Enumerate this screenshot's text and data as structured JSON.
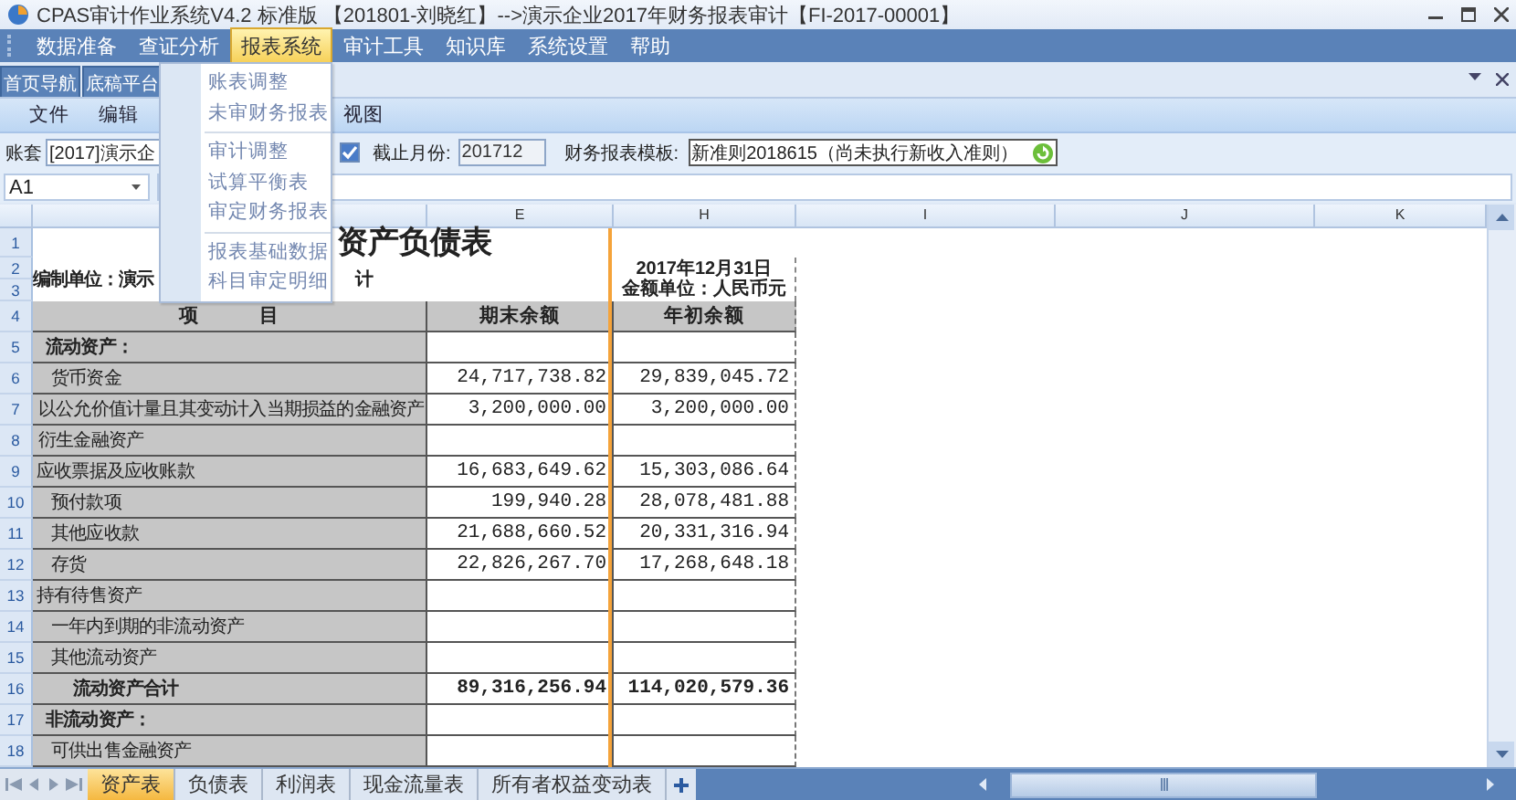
{
  "window": {
    "title": "CPAS审计作业系统V4.2 标准版 【201801-刘晓红】-->演示企业2017年财务报表审计【FI-2017-00001】"
  },
  "menu": [
    {
      "label": "数据准备",
      "selected": false
    },
    {
      "label": "查证分析",
      "selected": false
    },
    {
      "label": "报表系统",
      "selected": true
    },
    {
      "label": "审计工具",
      "selected": false
    },
    {
      "label": "知识库",
      "selected": false
    },
    {
      "label": "系统设置",
      "selected": false
    },
    {
      "label": "帮助",
      "selected": false
    }
  ],
  "dropdown": {
    "groups": [
      [
        "账表调整",
        "未审财务报表"
      ],
      [
        "审计调整",
        "试算平衡表",
        "审定财务报表"
      ],
      [
        "报表基础数据",
        "科目审定明细"
      ]
    ]
  },
  "nav_tabs": [
    {
      "label": "首页导航"
    },
    {
      "label": "底稿平台"
    }
  ],
  "ribbon": [
    "文件",
    "编辑",
    "视图"
  ],
  "filters": {
    "account_label": "账套",
    "account_value": "[2017]演示企",
    "account_checked": true,
    "month_label": "截止月份:",
    "month_value": "201712",
    "template_label": "财务报表模板:",
    "template_value": "新准则2018615（尚未执行新收入准则）"
  },
  "formula_bar": {
    "cell": "A1"
  },
  "sheet": {
    "columns": [
      "E",
      "H",
      "I",
      "J",
      "K"
    ],
    "top_rows": [
      "1",
      "2",
      "3",
      "4"
    ],
    "title": "资产负债表",
    "unit_prefix": "编制单位：演示",
    "unit_tail": "计",
    "date": "2017年12月31日",
    "currency": "金额单位：人民币元",
    "headers": [
      "项　　　目",
      "期末余额",
      "年初余额"
    ],
    "rows": [
      {
        "n": "5",
        "kind": "section",
        "item": "流动资产：",
        "end": "",
        "start": ""
      },
      {
        "n": "6",
        "kind": "sub",
        "item": "货币资金",
        "end": "24,717,738.82",
        "start": "29,839,045.72"
      },
      {
        "n": "7",
        "kind": "line",
        "item": "以公允价值计量且其变动计入当期损益的金融资产",
        "end": "3,200,000.00",
        "start": "3,200,000.00"
      },
      {
        "n": "8",
        "kind": "line",
        "item": "衍生金融资产",
        "end": "",
        "start": ""
      },
      {
        "n": "9",
        "kind": "top",
        "item": "应收票据及应收账款",
        "end": "16,683,649.62",
        "start": "15,303,086.64"
      },
      {
        "n": "10",
        "kind": "sub",
        "item": "预付款项",
        "end": "199,940.28",
        "start": "28,078,481.88"
      },
      {
        "n": "11",
        "kind": "sub",
        "item": "其他应收款",
        "end": "21,688,660.52",
        "start": "20,331,316.94"
      },
      {
        "n": "12",
        "kind": "sub",
        "item": "存货",
        "end": "22,826,267.70",
        "start": "17,268,648.18"
      },
      {
        "n": "13",
        "kind": "top",
        "item": "持有待售资产",
        "end": "",
        "start": ""
      },
      {
        "n": "14",
        "kind": "sub",
        "item": "一年内到期的非流动资产",
        "end": "",
        "start": ""
      },
      {
        "n": "15",
        "kind": "sub",
        "item": "其他流动资产",
        "end": "",
        "start": ""
      },
      {
        "n": "16",
        "kind": "total",
        "item": "流动资产合计",
        "end": "89,316,256.94",
        "start": "114,020,579.36"
      },
      {
        "n": "17",
        "kind": "section",
        "item": "非流动资产：",
        "end": "",
        "start": ""
      },
      {
        "n": "18",
        "kind": "sub",
        "item": "可供出售金融资产",
        "end": "",
        "start": ""
      }
    ]
  },
  "sheet_tabs": [
    {
      "label": "资产表",
      "selected": true
    },
    {
      "label": "负债表",
      "selected": false
    },
    {
      "label": "利润表",
      "selected": false
    },
    {
      "label": "现金流量表",
      "selected": false
    },
    {
      "label": "所有者权益变动表",
      "selected": false
    }
  ]
}
